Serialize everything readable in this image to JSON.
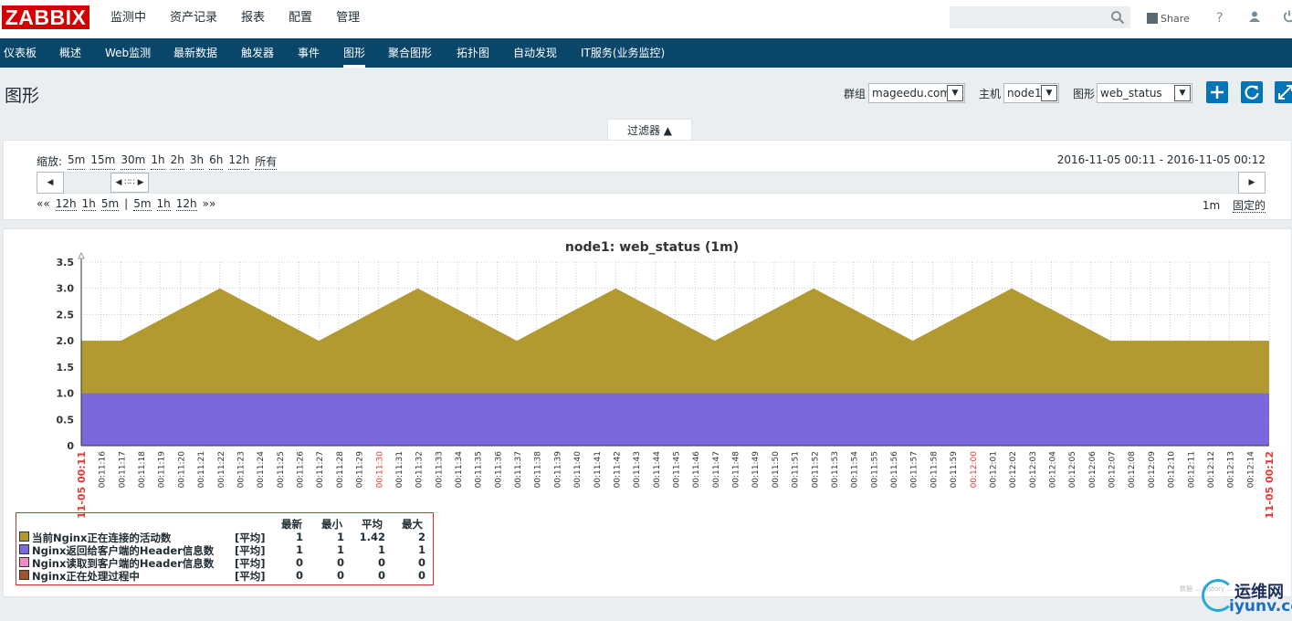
{
  "app": {
    "logo": "ZABBIX"
  },
  "main_menu": [
    {
      "label": "监测中"
    },
    {
      "label": "资产记录"
    },
    {
      "label": "报表"
    },
    {
      "label": "配置"
    },
    {
      "label": "管理"
    }
  ],
  "top_right": {
    "share_label": "Share",
    "help_glyph": "?",
    "icons": [
      "search-icon",
      "share-icon",
      "help-icon",
      "user-icon",
      "power-icon"
    ]
  },
  "sub_menu": [
    {
      "label": "仪表板"
    },
    {
      "label": "概述"
    },
    {
      "label": "Web监测"
    },
    {
      "label": "最新数据"
    },
    {
      "label": "触发器"
    },
    {
      "label": "事件"
    },
    {
      "label": "图形"
    },
    {
      "label": "聚合图形"
    },
    {
      "label": "拓扑图"
    },
    {
      "label": "自动发现"
    },
    {
      "label": "IT服务(业务监控)"
    }
  ],
  "page": {
    "title": "图形",
    "group_label": "群组",
    "group_value": "mageedu.com",
    "host_label": "主机",
    "host_value": "node1",
    "graph_label": "图形",
    "graph_value": "web_status"
  },
  "filter": {
    "tab_label": "过滤器 ▲",
    "zoom_label": "缩放:",
    "zoom_options": [
      "5m",
      "15m",
      "30m",
      "1h",
      "2h",
      "3h",
      "6h",
      "12h",
      "所有"
    ],
    "period": "2016-11-05 00:11 - 2016-11-05 00:12",
    "nav_start": "««",
    "nav_back": [
      "12h",
      "1h",
      "5m"
    ],
    "nav_sep": "|",
    "nav_fwd": [
      "5m",
      "1h",
      "12h"
    ],
    "nav_end": "»»",
    "current_step": "1m",
    "fixed_label": "固定的"
  },
  "chart_data": {
    "type": "area",
    "title": "node1: web_status (1m)",
    "ylim": [
      0,
      3.5
    ],
    "yticks": [
      "0",
      "0.5",
      "1.0",
      "1.5",
      "2.0",
      "2.5",
      "3.0",
      "3.5"
    ],
    "xtick_labels": [
      "11-05 00:11",
      "00:11:16",
      "00:11:17",
      "00:11:18",
      "00:11:19",
      "00:11:20",
      "00:11:21",
      "00:11:22",
      "00:11:23",
      "00:11:24",
      "00:11:25",
      "00:11:26",
      "00:11:27",
      "00:11:28",
      "00:11:29",
      "00:11:30",
      "00:11:31",
      "00:11:32",
      "00:11:33",
      "00:11:34",
      "00:11:35",
      "00:11:36",
      "00:11:37",
      "00:11:38",
      "00:11:39",
      "00:11:40",
      "00:11:41",
      "00:11:42",
      "00:11:43",
      "00:11:44",
      "00:11:45",
      "00:11:46",
      "00:11:47",
      "00:11:48",
      "00:11:49",
      "00:11:50",
      "00:11:51",
      "00:11:52",
      "00:11:53",
      "00:11:54",
      "00:11:55",
      "00:11:56",
      "00:11:57",
      "00:11:58",
      "00:11:59",
      "00:12:00",
      "00:12:01",
      "00:12:02",
      "00:12:03",
      "00:12:04",
      "00:12:05",
      "00:12:06",
      "00:12:07",
      "00:12:08",
      "00:12:09",
      "00:12:10",
      "00:12:11",
      "00:12:12",
      "00:12:13",
      "00:12:14",
      "11-05 00:12"
    ],
    "red_labels": [
      "11-05 00:11",
      "00:11:30",
      "00:12:00",
      "11-05 00:12"
    ],
    "grid": true,
    "series": [
      {
        "name": "Nginx返回给客户端的Header信息数",
        "color": "#7b68dd",
        "values": [
          1,
          1,
          1,
          1,
          1,
          1,
          1,
          1,
          1,
          1,
          1,
          1,
          1,
          1,
          1,
          1,
          1,
          1,
          1,
          1,
          1,
          1,
          1,
          1,
          1,
          1,
          1,
          1,
          1,
          1,
          1,
          1,
          1,
          1,
          1,
          1,
          1,
          1,
          1,
          1,
          1,
          1,
          1,
          1,
          1,
          1,
          1,
          1,
          1,
          1,
          1,
          1,
          1,
          1,
          1,
          1,
          1,
          1,
          1,
          1,
          1
        ]
      },
      {
        "name": "当前Nginx正在连接的活动数",
        "color": "#b39a30",
        "values": [
          2,
          2,
          2,
          2.2,
          2.4,
          2.6,
          2.8,
          3,
          2.8,
          2.6,
          2.4,
          2.2,
          2,
          2.2,
          2.4,
          2.6,
          2.8,
          3,
          2.8,
          2.6,
          2.4,
          2.2,
          2,
          2.2,
          2.4,
          2.6,
          2.8,
          3,
          2.8,
          2.6,
          2.4,
          2.2,
          2,
          2.2,
          2.4,
          2.6,
          2.8,
          3,
          2.8,
          2.6,
          2.4,
          2.2,
          2,
          2.2,
          2.4,
          2.6,
          2.8,
          3,
          2.8,
          2.6,
          2.4,
          2.2,
          2,
          2,
          2,
          2,
          2,
          2,
          2,
          2,
          2
        ]
      }
    ]
  },
  "legend": {
    "headers": [
      "最新",
      "最小",
      "平均",
      "最大"
    ],
    "rows": [
      {
        "color": "#b39a30",
        "name": "当前Nginx正在连接的活动数",
        "func": "[平均]",
        "last": "1",
        "min": "1",
        "avg": "1.42",
        "max": "2"
      },
      {
        "color": "#7b68dd",
        "name": "Nginx返回给客户端的Header信息数",
        "func": "[平均]",
        "last": "1",
        "min": "1",
        "avg": "1",
        "max": "1"
      },
      {
        "color": "#f18bc9",
        "name": "Nginx读取到客户端的Header信息数",
        "func": "[平均]",
        "last": "0",
        "min": "0",
        "avg": "0",
        "max": "0"
      },
      {
        "color": "#a0522d",
        "name": "Nginx正在处理过程中",
        "func": "[平均]",
        "last": "0",
        "min": "0",
        "avg": "0",
        "max": "0"
      }
    ]
  },
  "watermark": {
    "text": "数据 ... history ... 3 秒"
  },
  "brand": {
    "top": "运维网",
    "bottom": "iyunv.com"
  }
}
